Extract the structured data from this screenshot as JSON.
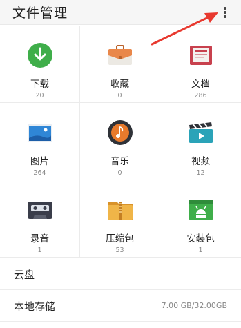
{
  "header": {
    "title": "文件管理",
    "more_icon": "more-vertical-icon"
  },
  "categories": [
    {
      "label": "下载",
      "count": "20",
      "icon": "download-icon",
      "color": "#3fae4a"
    },
    {
      "label": "收藏",
      "count": "0",
      "icon": "briefcase-icon",
      "color": "#e9874a"
    },
    {
      "label": "文档",
      "count": "286",
      "icon": "document-icon",
      "color": "#c8414e"
    },
    {
      "label": "图片",
      "count": "264",
      "icon": "image-icon",
      "color": "#2f86d6"
    },
    {
      "label": "音乐",
      "count": "0",
      "icon": "music-icon",
      "color": "#e87a2c"
    },
    {
      "label": "视频",
      "count": "12",
      "icon": "video-clapper-icon",
      "color": "#2aa3b8"
    },
    {
      "label": "录音",
      "count": "1",
      "icon": "cassette-icon",
      "color": "#3a3d4a"
    },
    {
      "label": "压缩包",
      "count": "53",
      "icon": "zip-folder-icon",
      "color": "#e7a83a"
    },
    {
      "label": "安装包",
      "count": "1",
      "icon": "android-package-icon",
      "color": "#3fae4a"
    }
  ],
  "storage": {
    "cloud_label": "云盘",
    "local_label": "本地存储",
    "local_value": "7.00 GB/32.00GB"
  },
  "annotation": {
    "arrow_color": "#e8392f"
  }
}
